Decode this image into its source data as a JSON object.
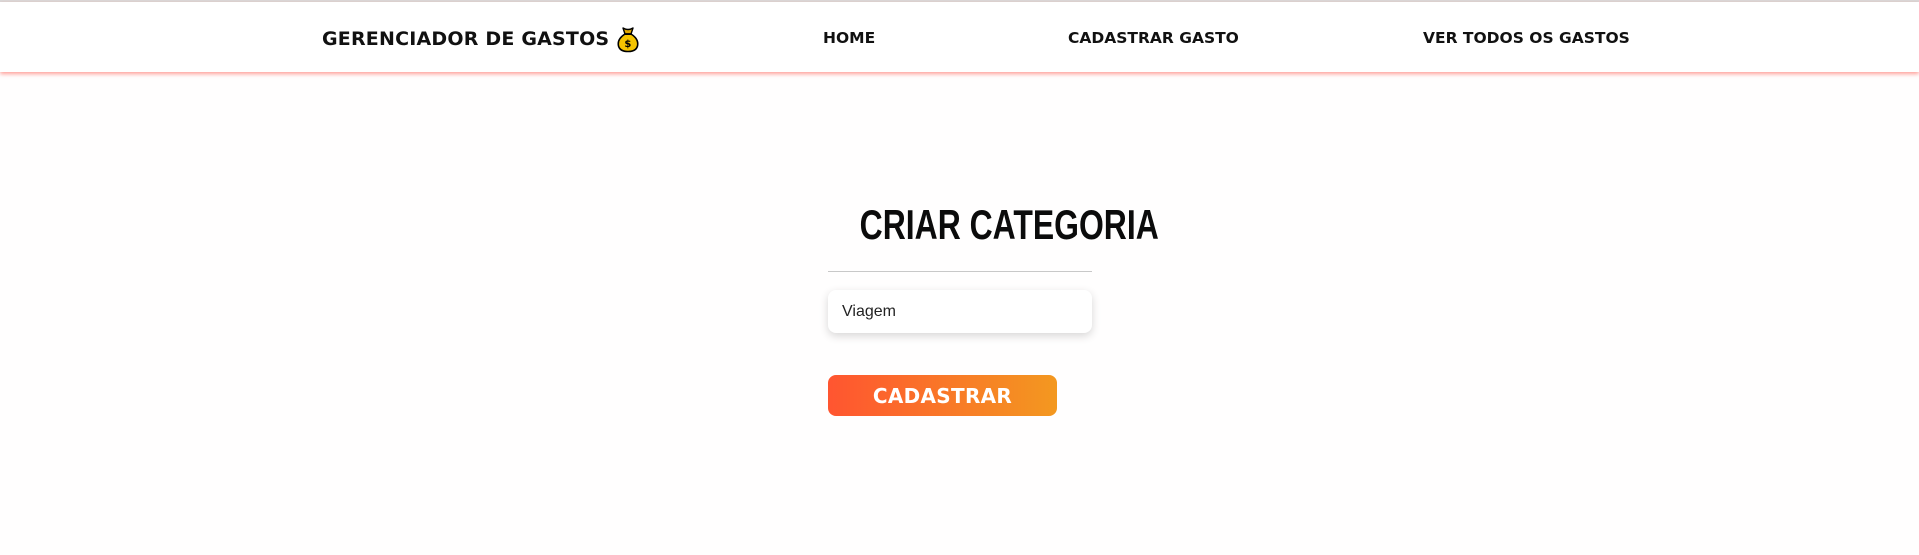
{
  "navbar": {
    "brand_text": "GERENCIADOR DE GASTOS",
    "brand_icon": "money-bag-icon",
    "links": [
      {
        "label": "HOME"
      },
      {
        "label": "CADASTRAR GASTO"
      },
      {
        "label": "VER TODOS OS GASTOS"
      }
    ],
    "shadow_color": "#ff5046"
  },
  "form": {
    "title": "CRIAR CATEGORIA",
    "category_input": {
      "value": "Viagem",
      "placeholder": ""
    },
    "submit_label": "CADASTRAR",
    "button_gradient": [
      "#ff5530",
      "#f39820"
    ]
  }
}
